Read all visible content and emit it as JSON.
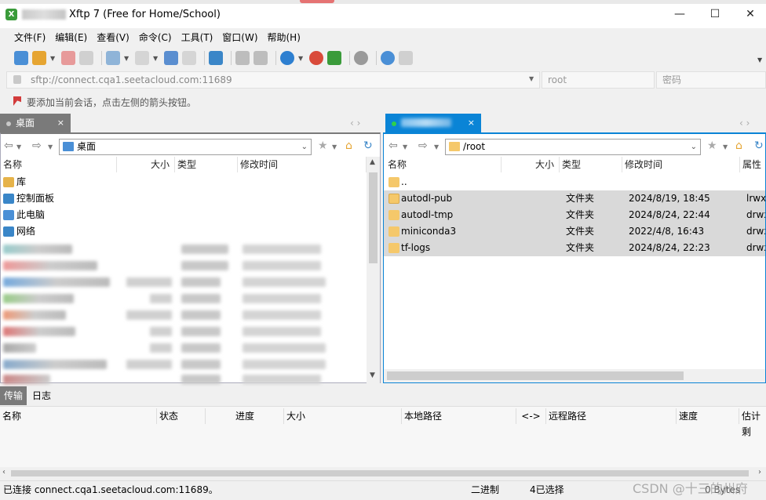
{
  "window": {
    "title": "Xftp 7 (Free for Home/School)",
    "app_icon_glyph": "X",
    "controls": {
      "minimize": "—",
      "maximize": "☐",
      "close": "✕"
    }
  },
  "menu": [
    "文件(F)",
    "编辑(E)",
    "查看(V)",
    "命令(C)",
    "工具(T)",
    "窗口(W)",
    "帮助(H)"
  ],
  "toolbar_icons": [
    "new-session-icon",
    "open-folder-icon",
    "disconnect-icon",
    "reconnect-icon",
    "new-tab-icon",
    "terminal-icon",
    "sync-icon",
    "copy-icon",
    "paste-icon",
    "transfer-icon",
    "properties-icon",
    "globe-icon",
    "netsarang-icon",
    "xshell-icon",
    "settings-icon",
    "help-icon",
    "chat-icon"
  ],
  "address": {
    "value": "sftp://connect.cqa1.seetacloud.com:11689",
    "user_placeholder": "root",
    "password_placeholder": "密码"
  },
  "hint": "要添加当前会话，点击左侧的箭头按钮。",
  "tabs": {
    "local": {
      "label": "桌面",
      "close": "×"
    },
    "remote": {
      "close": "×"
    },
    "nav_arrows": "‹  ›"
  },
  "local": {
    "path": "桌面",
    "columns": [
      "名称",
      "大小",
      "类型",
      "修改时间"
    ],
    "items": [
      {
        "name": "库",
        "icon_color": "#e6b34a"
      },
      {
        "name": "控制面板",
        "icon_color": "#3a86c8"
      },
      {
        "name": "此电脑",
        "icon_color": "#4a8fd6"
      },
      {
        "name": "网络",
        "icon_color": "#3a86c8"
      }
    ]
  },
  "remote": {
    "path": "/root",
    "columns": [
      "名称",
      "大小",
      "类型",
      "修改时间",
      "属性"
    ],
    "parent": "..",
    "items": [
      {
        "name": "autodl-pub",
        "type": "文件夹",
        "modified": "2024/8/19, 18:45",
        "attr": "lrwxr"
      },
      {
        "name": "autodl-tmp",
        "type": "文件夹",
        "modified": "2024/8/24, 22:44",
        "attr": "drwx"
      },
      {
        "name": "miniconda3",
        "type": "文件夹",
        "modified": "2022/4/8, 16:43",
        "attr": "drwx"
      },
      {
        "name": "tf-logs",
        "type": "文件夹",
        "modified": "2024/8/24, 22:23",
        "attr": "drwx"
      }
    ]
  },
  "transfer": {
    "tabs": [
      "传输",
      "日志"
    ],
    "columns": [
      "名称",
      "状态",
      "进度",
      "大小",
      "本地路径",
      "<->",
      "远程路径",
      "速度",
      "估计剩"
    ]
  },
  "status": {
    "connected": "已连接 connect.cqa1.seetacloud.com:11689。",
    "mode": "二进制",
    "selection": "4已选择",
    "bytes": "0 Bytes"
  },
  "watermark": "CSDN @十三的州府",
  "colors": {
    "accent": "#0a84d6",
    "folder": "#f5c86a",
    "selected_row": "#d9d9d9"
  }
}
